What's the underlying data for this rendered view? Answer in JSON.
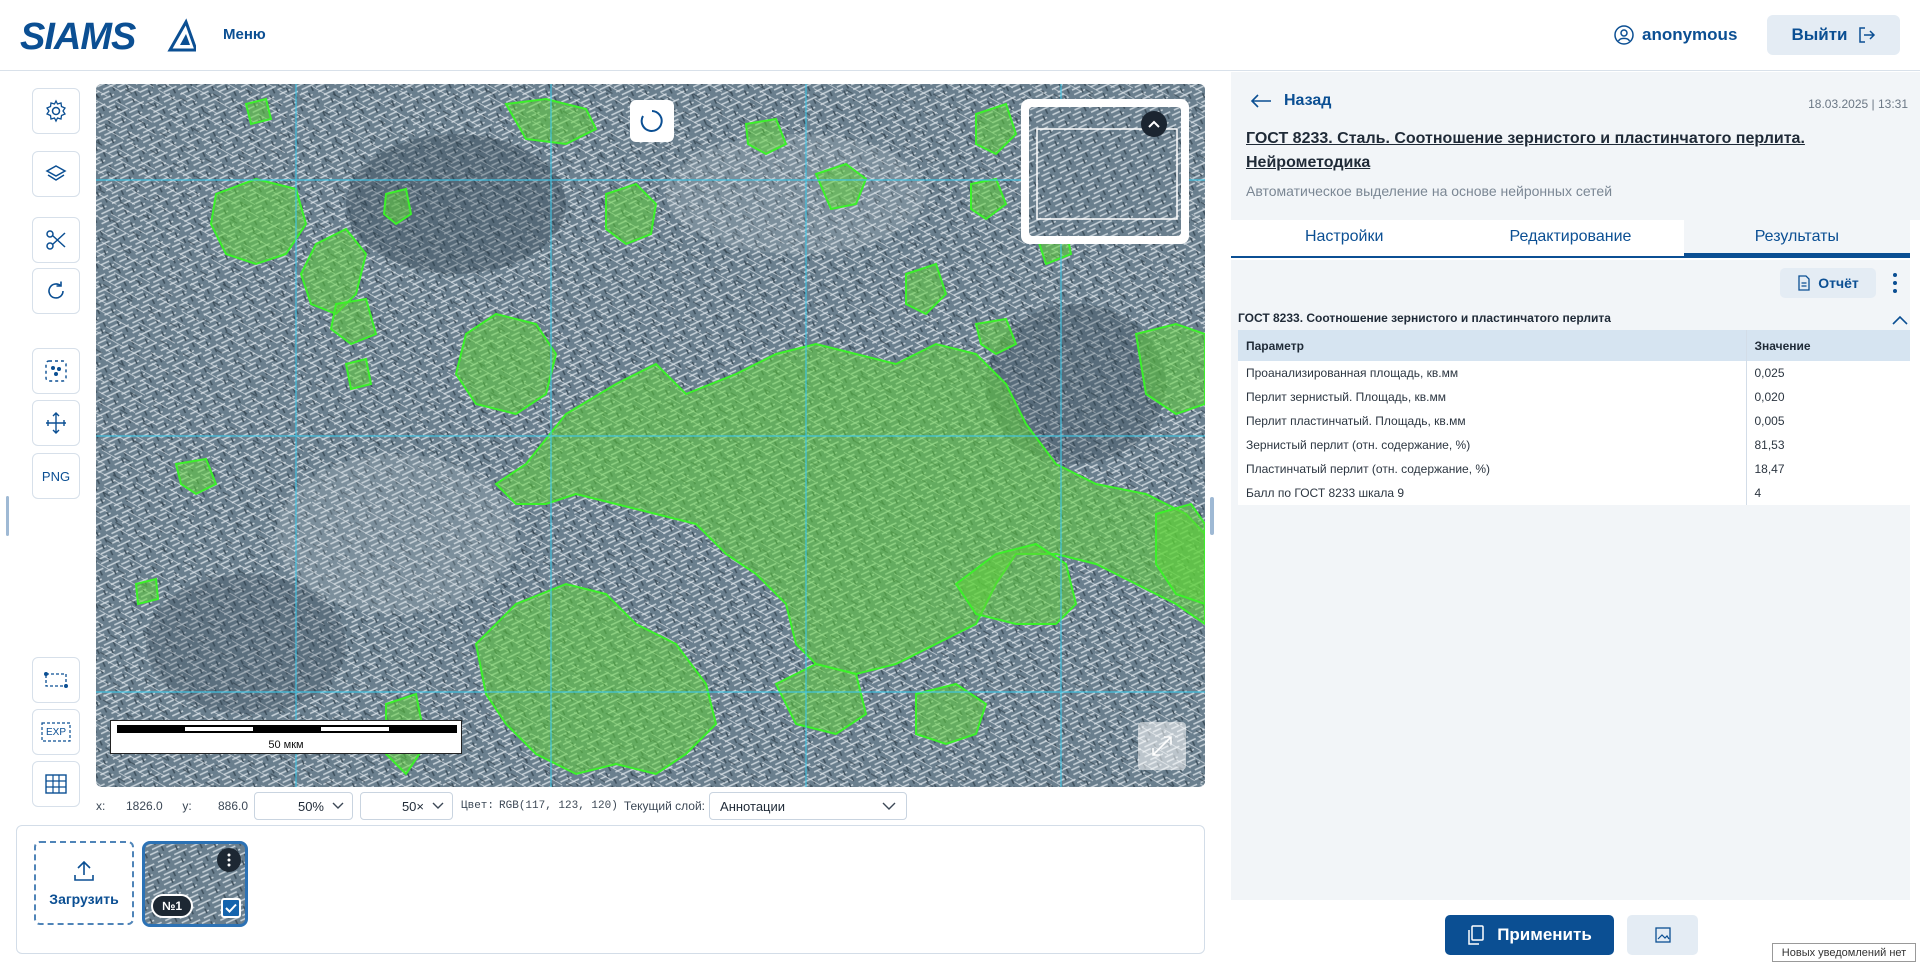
{
  "header": {
    "logo_text": "SIAMS",
    "menu_label": "Меню",
    "user_name": "anonymous",
    "logout_label": "Выйти"
  },
  "toolbar": {
    "png_label": "PNG",
    "exp_label": "EXP"
  },
  "viewer": {
    "scalebar_label": "50 мкм"
  },
  "statusbar": {
    "x_label": "x:",
    "x_value": "1826.0",
    "y_label": "y:",
    "y_value": "886.0",
    "zoom": "50%",
    "brightness": "50×",
    "color_label": "Цвет:",
    "color_value": "RGB(117, 123, 120)",
    "layer_label": "Текущий слой:",
    "layer_value": "Аннотации"
  },
  "gallery": {
    "upload_label": "Загрузить",
    "thumb_number": "№1"
  },
  "panel": {
    "back_label": "Назад",
    "date": "18.03.2025 | 13:31",
    "method_title": "ГОСТ 8233. Сталь. Соотношение зернистого и пластинчатого перлита. Нейрометодика",
    "method_subtitle": "Автоматическое выделение на основе нейронных сетей",
    "tabs": [
      {
        "label": "Настройки"
      },
      {
        "label": "Редактирование"
      },
      {
        "label": "Результаты"
      }
    ],
    "report_label": "Отчёт",
    "section_title": "ГОСТ 8233. Соотношение зернистого и пластинчатого перлита",
    "table": {
      "headers": [
        "Параметр",
        "Значение"
      ],
      "rows": [
        [
          "Проанализированная площадь, кв.мм",
          "0,025"
        ],
        [
          "Перлит зернистый. Площадь, кв.мм",
          "0,020"
        ],
        [
          "Перлит пластинчатый. Площадь, кв.мм",
          "0,005"
        ],
        [
          "Зернистый перлит (отн. содержание, %)",
          "81,53"
        ],
        [
          "Пластинчатый перлит (отн. содержание, %)",
          "18,47"
        ],
        [
          "Балл по ГОСТ 8233 шкала 9",
          "4"
        ]
      ]
    },
    "apply_label": "Применить"
  },
  "notification": "Новых уведомлений нет",
  "colors": {
    "brand": "#0b4f93",
    "annotation_fill": "#5fd23a",
    "grid_line": "#3fc8e8"
  }
}
